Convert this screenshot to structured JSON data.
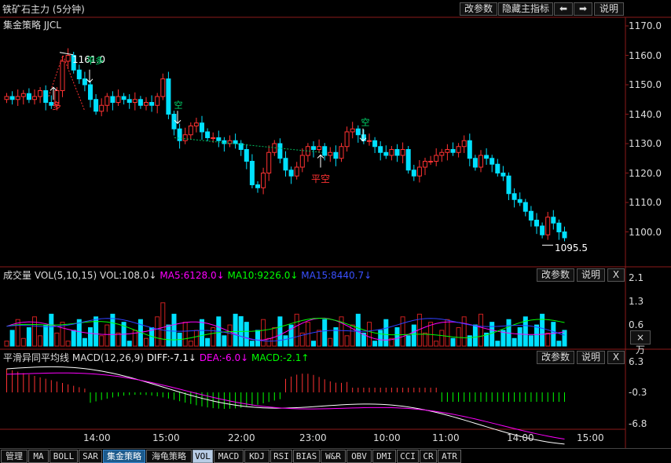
{
  "header": {
    "title": "铁矿石主力 (5分钟)",
    "buttons": [
      "改参数",
      "隐藏主指标",
      "⬅",
      "➡",
      "说明"
    ]
  },
  "main_panel": {
    "indicator": "集金策略 JJCL",
    "y_ticks": [
      "1170.0",
      "1160.0",
      "1150.0",
      "1140.0",
      "1130.0",
      "1120.0",
      "1110.0",
      "1100.0"
    ],
    "high_label": "1161.0",
    "low_label": "1095.5",
    "signals": {
      "duo": "多",
      "kong1": "空",
      "pingkong": "平空",
      "kong2": "空",
      "pingduo": "平多"
    }
  },
  "volume_panel": {
    "name": "成交量",
    "params": "VOL(5,10,15)",
    "vol": "VOL:108.0↓",
    "ma5": "MA5:6128.0↓",
    "ma10": "MA10:9226.0↓",
    "ma15": "MA15:8440.7↓",
    "y_ticks": [
      "2.1",
      "1.3",
      "0.6"
    ],
    "unit_button": "×万",
    "buttons": [
      "改参数",
      "说明",
      "X"
    ]
  },
  "macd_panel": {
    "name": "平滑异同平均线",
    "params": "MACD(12,26,9)",
    "diff": "DIFF:-7.1↓",
    "dea": "DEA:-6.0↓",
    "macd": "MACD:-2.1↑",
    "y_ticks": [
      "6.3",
      "-0.3",
      "-6.8"
    ],
    "buttons": [
      "改参数",
      "说明",
      "X"
    ]
  },
  "x_axis": [
    "14:00",
    "15:00",
    "22:00",
    "23:00",
    "10:00",
    "11:00",
    "14:00",
    "15:00"
  ],
  "tabs": [
    "管理",
    "MA",
    "BOLL",
    "SAR",
    "集金策略",
    "海龟策略",
    "VOL",
    "MACD",
    "KDJ",
    "RSI",
    "BIAS",
    "W&R",
    "OBV",
    "DMI",
    "CCI",
    "CR",
    "ATR"
  ],
  "colors": {
    "up": "#ff3232",
    "down": "#00e0ff",
    "ma5": "#ff00ff",
    "ma10": "#00ff00",
    "ma15": "#3040ff",
    "diff": "#ffffff",
    "dea": "#ff00ff"
  }
}
